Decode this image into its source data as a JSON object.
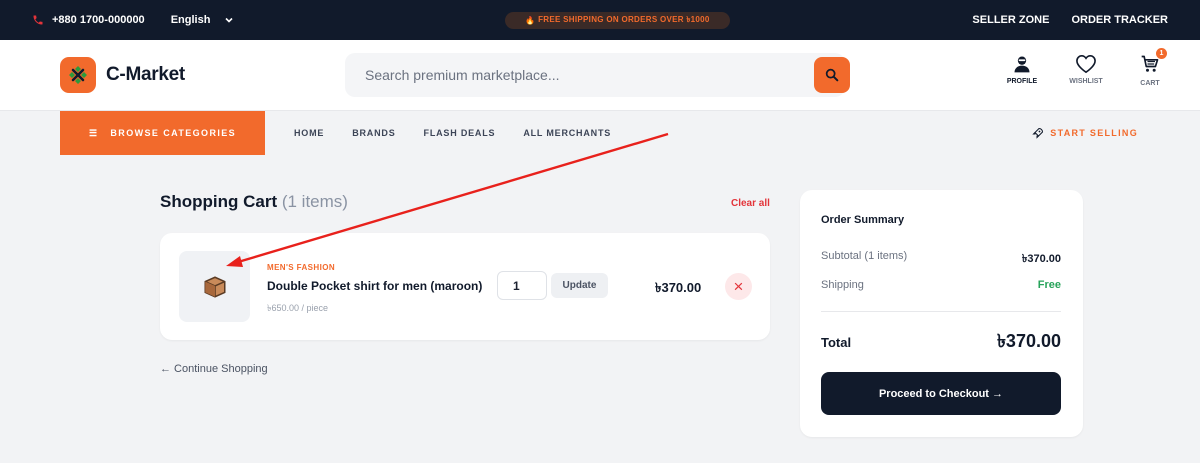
{
  "topbar": {
    "phone": "+880 1700-000000",
    "language": "English",
    "promo": "FREE SHIPPING ON ORDERS OVER ৳1000",
    "links": [
      "SELLER ZONE",
      "ORDER TRACKER"
    ]
  },
  "header": {
    "brand": "C-Market",
    "search_placeholder": "Search premium marketplace...",
    "icons": [
      {
        "label": "PROFILE",
        "icon": "profile-icon"
      },
      {
        "label": "WISHLIST",
        "icon": "heart-icon"
      },
      {
        "label": "CART",
        "icon": "cart-icon"
      }
    ],
    "cart_count": "1"
  },
  "nav": {
    "browse_label": "BROWSE CATEGORIES",
    "links": [
      "HOME",
      "BRANDS",
      "FLASH DEALS",
      "ALL MERCHANTS"
    ],
    "start_selling": "START SELLING"
  },
  "cart": {
    "title": "Shopping Cart",
    "count_text": "(1 items)",
    "clear_label": "Clear all",
    "items": [
      {
        "category": "MEN'S FASHION",
        "name": "Double Pocket shirt for men (maroon)",
        "unit_price": "৳650.00 / piece",
        "quantity": "1",
        "update_label": "Update",
        "line_total": "৳370.00"
      }
    ],
    "continue_label": "← Continue Shopping"
  },
  "summary": {
    "title": "Order Summary",
    "subtotal_label": "Subtotal (1 items)",
    "subtotal_value": "৳370.00",
    "shipping_label": "Shipping",
    "shipping_value": "Free",
    "total_label": "Total",
    "total_value": "৳370.00",
    "checkout_label": "Proceed to Checkout →"
  },
  "colors": {
    "accent": "#f26a2c",
    "dark": "#111a2b",
    "success": "#27a35a",
    "danger": "#e3343a",
    "annotation_arrow": "#e8211c"
  }
}
